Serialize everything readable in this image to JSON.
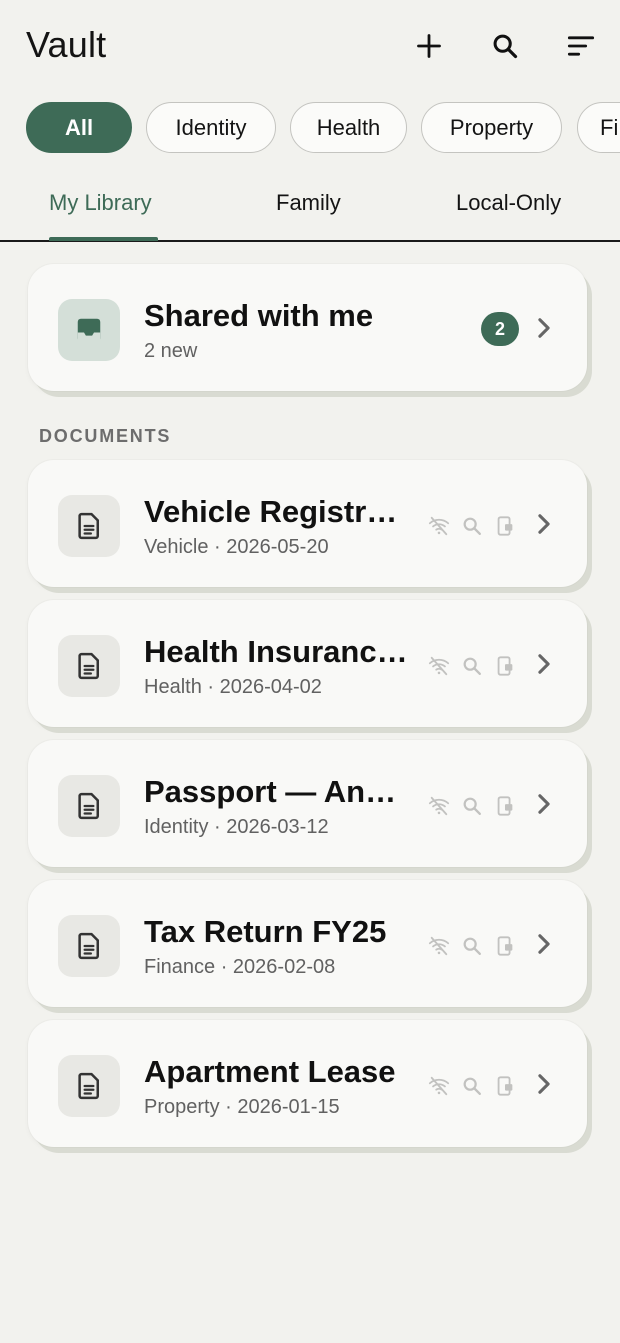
{
  "app": {
    "title": "Vault",
    "accent_color": "#3e6b57",
    "header_actions": [
      {
        "name": "add",
        "icon": "plus-icon"
      },
      {
        "name": "search",
        "icon": "search-icon"
      },
      {
        "name": "sort",
        "icon": "sort-icon"
      }
    ]
  },
  "filters": {
    "chips": [
      {
        "label": "All",
        "active": true
      },
      {
        "label": "Identity",
        "active": false
      },
      {
        "label": "Health",
        "active": false
      },
      {
        "label": "Property",
        "active": false
      },
      {
        "label": "Fi",
        "active": false
      }
    ]
  },
  "tabs": {
    "items": [
      {
        "label": "My Library",
        "active": true
      },
      {
        "label": "Family",
        "active": false
      },
      {
        "label": "Local-Only",
        "active": false
      }
    ]
  },
  "shared": {
    "title": "Shared with me",
    "subtitle": "2 new",
    "badge": "2",
    "icon": "inbox-icon"
  },
  "documents": {
    "section_label": "DOCUMENTS",
    "items": [
      {
        "title": "Vehicle Registration",
        "subtitle": "Vehicle · 2026-05-20",
        "icon": "document-icon",
        "status_icons": [
          "offline-icon",
          "search-icon",
          "device-lock-icon"
        ]
      },
      {
        "title": "Health Insurance Policy",
        "subtitle": "Health · 2026-04-02",
        "icon": "document-icon",
        "status_icons": [
          "offline-icon",
          "search-icon",
          "device-lock-icon"
        ]
      },
      {
        "title": "Passport — Anaya",
        "subtitle": "Identity · 2026-03-12",
        "icon": "document-icon",
        "status_icons": [
          "offline-icon",
          "search-icon",
          "device-lock-icon"
        ]
      },
      {
        "title": "Tax Return FY25",
        "subtitle": "Finance · 2026-02-08",
        "icon": "document-icon",
        "status_icons": [
          "offline-icon",
          "search-icon",
          "device-lock-icon"
        ]
      },
      {
        "title": "Apartment Lease",
        "subtitle": "Property · 2026-01-15",
        "icon": "document-icon",
        "status_icons": [
          "offline-icon",
          "search-icon",
          "device-lock-icon"
        ]
      }
    ]
  }
}
